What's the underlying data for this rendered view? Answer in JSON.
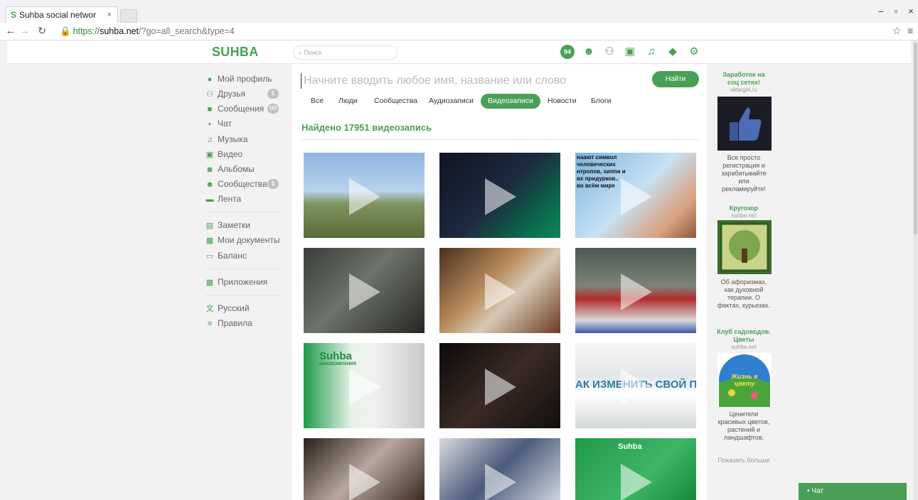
{
  "browser": {
    "tab_title": "Suhba social networ",
    "tab_favicon": "S",
    "url_scheme": "https://",
    "url_host": "suhba.net",
    "url_path": "/?go=all_search&type=4"
  },
  "header": {
    "logo": "SUHBA",
    "search_placeholder": "Поиск",
    "notification_count": "94",
    "icons": [
      "badge-94",
      "groups-icon",
      "friends-icon",
      "video-icon",
      "music-icon",
      "education-icon",
      "settings-icon"
    ]
  },
  "sidebar": {
    "items": [
      {
        "label": "Мой профиль",
        "icon": "profile-icon"
      },
      {
        "label": "Друзья",
        "icon": "friends-icon",
        "count": "1"
      },
      {
        "label": "Сообщения",
        "icon": "messages-icon",
        "count": "123"
      },
      {
        "label": "Чат",
        "icon": "chat-icon"
      },
      {
        "label": "Музыка",
        "icon": "music-icon"
      },
      {
        "label": "Видео",
        "icon": "video-icon"
      },
      {
        "label": "Альбомы",
        "icon": "albums-icon"
      },
      {
        "label": "Сообщества",
        "icon": "communities-icon",
        "count": "1"
      },
      {
        "label": "Лента",
        "icon": "news-icon"
      },
      {
        "label": "Заметки",
        "icon": "notes-icon"
      },
      {
        "label": "Мои документы",
        "icon": "documents-icon"
      },
      {
        "label": "Баланс",
        "icon": "balance-icon"
      },
      {
        "label": "Приложения",
        "icon": "apps-icon"
      },
      {
        "label": "Русский",
        "icon": "language-icon"
      },
      {
        "label": "Правила",
        "icon": "rules-icon"
      }
    ]
  },
  "main": {
    "query_placeholder": "Начните вводить любое имя, название или слово",
    "find_button": "Найти",
    "tabs": [
      "Все",
      "Люди",
      "Сообщества",
      "Аудиозаписи",
      "Видеозаписи",
      "Новости",
      "Блоги"
    ],
    "active_tab": "Видеозаписи",
    "found_text": "Найдено 17951 видеозапись",
    "thumb_captions": {
      "v3": "наают символ\nчеловеческих\nнтропов, хиппи и\nих придурков..\nво всём мире",
      "v7_logo": "Suhba",
      "v7_sub": "КИНОКОМПАНИЯ",
      "v9": "АК ИЗМЕНИТЬ СВОЙ ПОЧЕР",
      "v12": "Suhba"
    }
  },
  "ads": [
    {
      "title": "Заработок на соц сетях!",
      "source": "vktarget.ru",
      "text": "Все просто регистрация и зарабатывайте или рекламируйте!"
    },
    {
      "title": "Кругозор",
      "source": "suhba.net",
      "text": "Об афоризмах, как духовной терапии. О фактах, курьезах."
    },
    {
      "title": "Клуб садоводов. Цветы",
      "source": "suhba.net",
      "text": "Ценители красивых цветов, растений и ландшафтов."
    }
  ],
  "ad_image_text": {
    "ad3": "Жизнь в цвету"
  },
  "show_more": "Показать больше",
  "chat_bar": "Чат",
  "colors": {
    "accent": "#4a9f56",
    "page_bg": "#f2f2f2"
  }
}
